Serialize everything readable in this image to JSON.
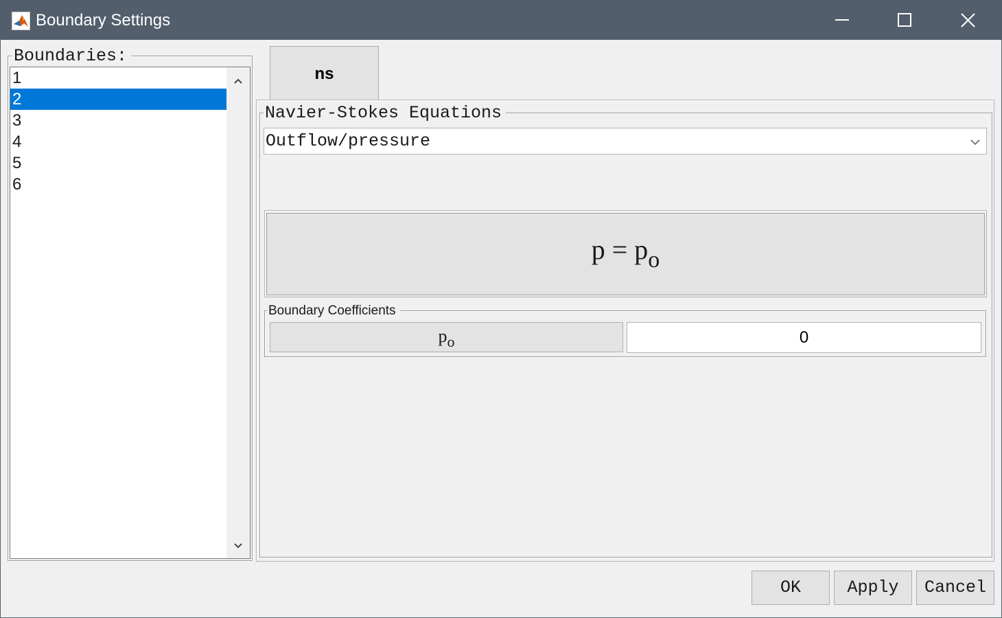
{
  "window": {
    "title": "Boundary Settings",
    "icons": {
      "app": "matlab-icon",
      "minimize": "minimize-icon",
      "maximize": "maximize-icon",
      "close": "close-icon"
    },
    "colors": {
      "titlebar": "#525e6c",
      "selection": "#0078d7"
    }
  },
  "boundaries": {
    "label": "Boundaries:",
    "items": [
      "1",
      "2",
      "3",
      "4",
      "5",
      "6"
    ],
    "selected": "2"
  },
  "tab": {
    "label": "ns"
  },
  "equations": {
    "group_label": "Navier-Stokes Equations",
    "condition": "Outflow/pressure",
    "formula_lhs": "p = p",
    "formula_sub": "o"
  },
  "coefficients": {
    "group_label": "Boundary Coefficients",
    "name": "p",
    "name_sub": "o",
    "value": "0"
  },
  "buttons": {
    "ok": "OK",
    "apply": "Apply",
    "cancel": "Cancel"
  }
}
